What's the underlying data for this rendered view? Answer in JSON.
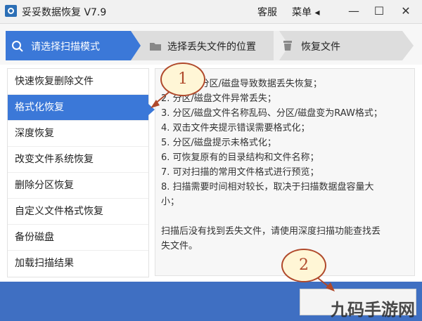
{
  "window": {
    "title": "妥妥数据恢复 V7.9",
    "menu_service": "客服",
    "menu_menu": "菜单 ◂",
    "btn_minimize": "—",
    "btn_maximize": "☐",
    "btn_close": "✕"
  },
  "steps": [
    {
      "label": "请选择扫描模式",
      "icon": "search-icon",
      "active": true
    },
    {
      "label": "选择丢失文件的位置",
      "icon": "folder-icon",
      "active": false
    },
    {
      "label": "恢复文件",
      "icon": "trash-icon",
      "active": false
    }
  ],
  "modes": [
    {
      "label": "快速恢复删除文件",
      "active": false
    },
    {
      "label": "格式化恢复",
      "active": true
    },
    {
      "label": "深度恢复",
      "active": false
    },
    {
      "label": "改变文件系统恢复",
      "active": false
    },
    {
      "label": "删除分区恢复",
      "active": false
    },
    {
      "label": "自定义文件格式恢复",
      "active": false
    },
    {
      "label": "备份磁盘",
      "active": false
    },
    {
      "label": "加载扫描结果",
      "active": false
    }
  ],
  "description": {
    "lines": [
      "1. 格式化分区/磁盘导致数据丢失恢复；",
      "2. 分区/磁盘文件异常丢失；",
      "3. 分区/磁盘文件名称乱码、分区/磁盘变为RAW格式；",
      "4. 双击文件夹提示错误需要格式化；",
      "5. 分区/磁盘提示未格式化；",
      "6. 可恢复原有的目录结构和文件名称；",
      "7. 可对扫描的常用文件格式进行预览；",
      "8. 扫描需要时间相对较长，取决于扫描数据盘容量大",
      "小；",
      "",
      "扫描后没有找到丢失文件，请使用深度扫描功能查找丢",
      "失文件。"
    ]
  },
  "annotations": [
    "1",
    "2"
  ],
  "watermark": "九码手游网",
  "colors": {
    "accent": "#3b78d8",
    "bottom": "#3f6fc2",
    "annotation": "#b0492b"
  }
}
